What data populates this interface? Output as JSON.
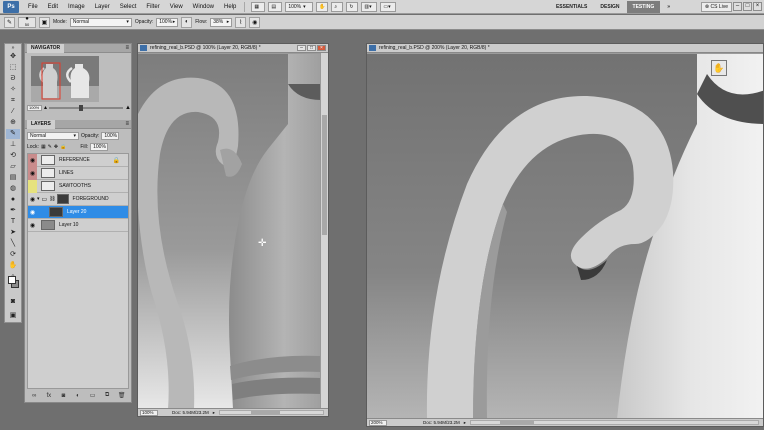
{
  "menubar": {
    "logo": "Ps",
    "items": [
      "File",
      "Edit",
      "Image",
      "Layer",
      "Select",
      "Filter",
      "View",
      "Window",
      "Help"
    ],
    "zoom_value": "100%",
    "workspaces": [
      "ESSENTIALS",
      "DESIGN",
      "TESTING"
    ],
    "active_workspace": "TESTING",
    "cs_live": "CS Live",
    "window_controls": [
      "–",
      "□",
      "×"
    ]
  },
  "options": {
    "brush_size": "50",
    "mode_label": "Mode:",
    "mode_value": "Normal",
    "opacity_label": "Opacity:",
    "opacity_value": "100%",
    "flow_label": "Flow:",
    "flow_value": "38%"
  },
  "navigator": {
    "title": "NAVIGATOR",
    "zoom": "100%"
  },
  "layers": {
    "title": "LAYERS",
    "blend_mode": "Normal",
    "opacity_label": "Opacity:",
    "opacity_value": "100%",
    "lock_label": "Lock:",
    "fill_label": "Fill:",
    "fill_value": "100%",
    "items": [
      {
        "name": "REFERENCE",
        "tag": "red"
      },
      {
        "name": "LINES",
        "tag": "red"
      },
      {
        "name": "SAWTOOTHS",
        "tag": "yellow"
      },
      {
        "name": "FOREGROUND",
        "tag": "group"
      },
      {
        "name": "Layer 20",
        "tag": "selected"
      },
      {
        "name": "Layer 10",
        "tag": "plain"
      }
    ]
  },
  "doc1": {
    "title": "refining_real_b.PSD @ 100% (Layer 20, RGB/8) *",
    "zoom": "100%",
    "info": "Doc: 5.94M/23.2M"
  },
  "doc2": {
    "title": "refining_real_b.PSD @ 200% (Layer 20, RGB/8) *",
    "zoom": "200%",
    "info": "Doc: 5.94M/23.2M"
  },
  "colors": {
    "menubar_bg": "#d6d6d6",
    "selected_layer": "#2f8ce6",
    "workspace_active": "#7d7d7d"
  }
}
